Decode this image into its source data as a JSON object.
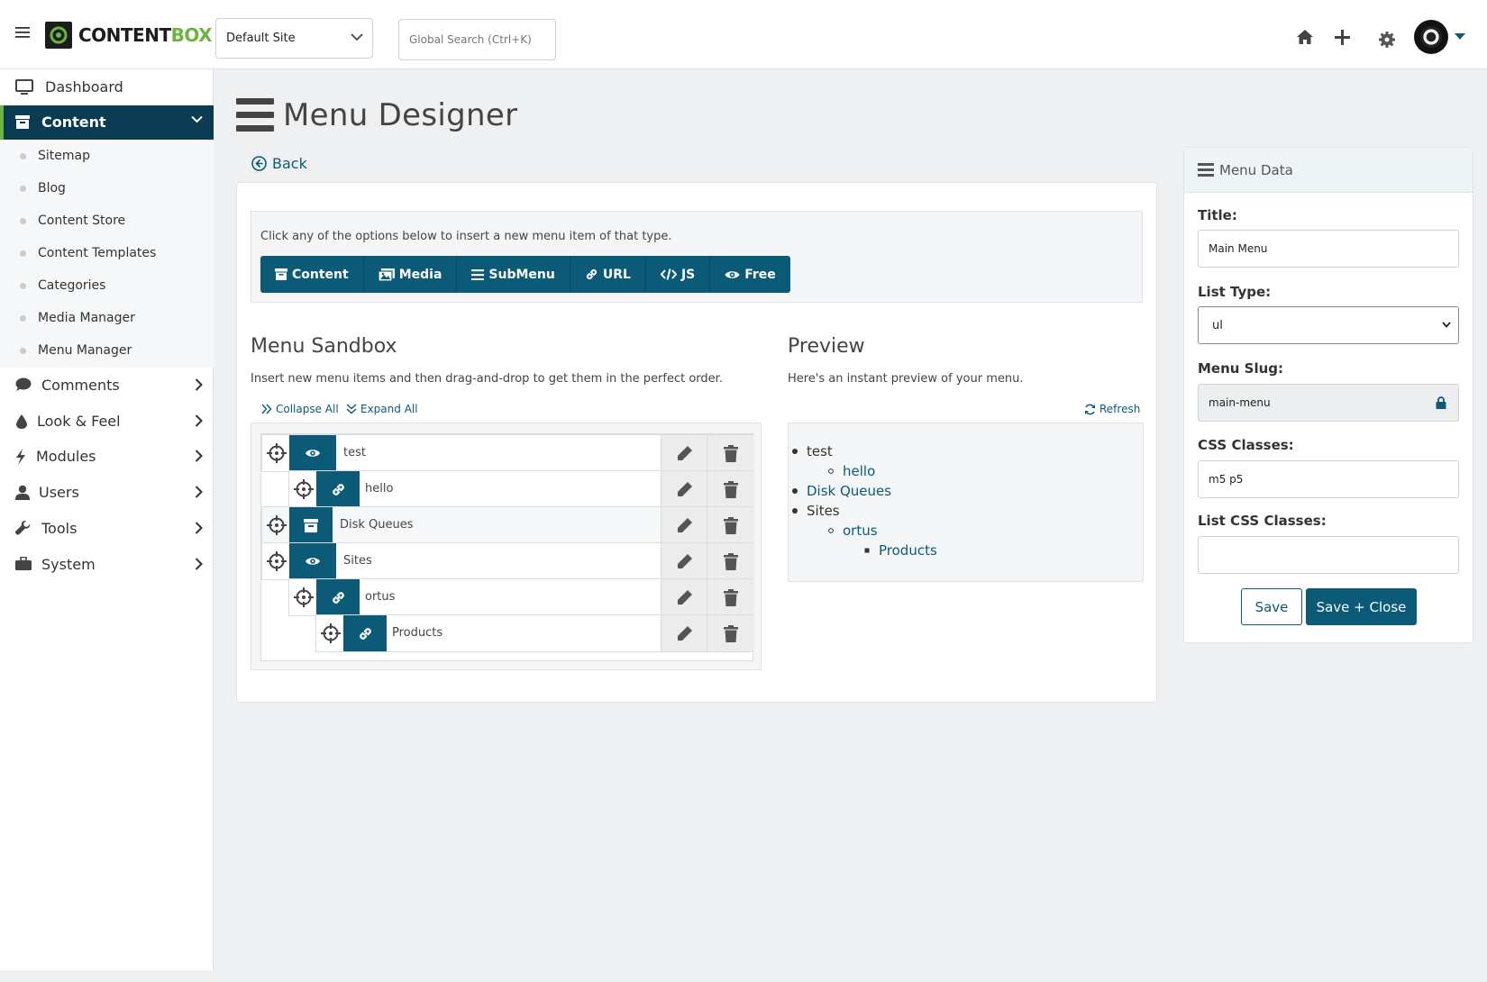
{
  "brand": {
    "name_part1": "CONTENT",
    "name_part2": "BOX",
    "accent": "#6db33f",
    "primary": "#0b5a78",
    "nav_active": "#0b3b52"
  },
  "header": {
    "site_select": "Default Site",
    "search_placeholder": "Global Search (Ctrl+K)",
    "icons": [
      "home-icon",
      "plus-icon",
      "gear-icon",
      "avatar"
    ]
  },
  "sidebar": {
    "dashboard": "Dashboard",
    "content": "Content",
    "content_items": [
      "Sitemap",
      "Blog",
      "Content Store",
      "Content Templates",
      "Categories",
      "Media Manager",
      "Menu Manager"
    ],
    "comments": "Comments",
    "look_feel": "Look & Feel",
    "modules": "Modules",
    "users": "Users",
    "tools": "Tools",
    "system": "System"
  },
  "main": {
    "title": "Menu Designer",
    "back": "Back",
    "insert_hint": "Click any of the options below to insert a new menu item of that type.",
    "insert_buttons": [
      "Content",
      "Media",
      "SubMenu",
      "URL",
      "JS",
      "Free"
    ],
    "sandbox": {
      "title": "Menu Sandbox",
      "subtitle": "Insert new menu items and then drag-and-drop to get them in the perfect order.",
      "collapse_all": "Collapse All",
      "expand_all": "Expand All",
      "items": [
        {
          "label": "test",
          "type": "eye-icon",
          "level": 0
        },
        {
          "label": "hello",
          "type": "link-icon",
          "level": 1
        },
        {
          "label": "Disk Queues",
          "type": "archive-icon",
          "level": 0
        },
        {
          "label": "Sites",
          "type": "eye-icon",
          "level": 0
        },
        {
          "label": "ortus",
          "type": "link-icon",
          "level": 1
        },
        {
          "label": "Products",
          "type": "link-icon",
          "level": 2
        }
      ]
    },
    "preview": {
      "title": "Preview",
      "subtitle": "Here's an instant preview of your menu.",
      "refresh": "Refresh",
      "items": [
        {
          "label": "test",
          "level": 0,
          "link": false
        },
        {
          "label": "hello",
          "level": 1,
          "link": true
        },
        {
          "label": "Disk Queues",
          "level": 0,
          "link": true
        },
        {
          "label": "Sites",
          "level": 0,
          "link": false
        },
        {
          "label": "ortus",
          "level": 1,
          "link": true
        },
        {
          "label": "Products",
          "level": 2,
          "link": true
        }
      ]
    }
  },
  "menu_data": {
    "header": "Menu Data",
    "title_label": "Title:",
    "title_value": "Main Menu",
    "list_type_label": "List Type:",
    "list_type_value": "ul",
    "slug_label": "Menu Slug:",
    "slug_value": "main-menu",
    "css_label": "CSS Classes:",
    "css_value": "m5 p5",
    "list_css_label": "List CSS Classes:",
    "list_css_value": "",
    "save": "Save",
    "save_close": "Save + Close"
  }
}
